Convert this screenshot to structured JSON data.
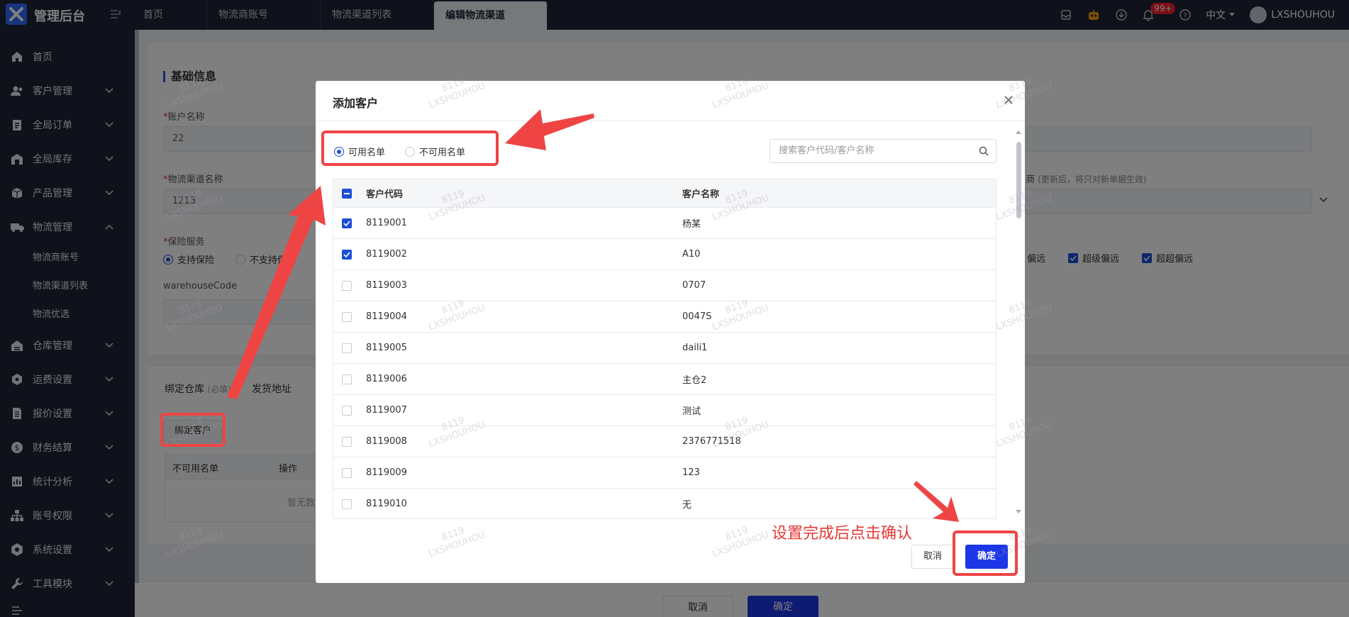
{
  "app": {
    "title": "管理后台",
    "accent": "#1d36e6",
    "top_bg": "#1f2236"
  },
  "tabs": [
    {
      "label": "首页"
    },
    {
      "label": "物流商账号"
    },
    {
      "label": "物流渠道列表"
    },
    {
      "label": "编辑物流渠道"
    }
  ],
  "header": {
    "notify_count": "99+",
    "language": "中文",
    "user": "LXSHOUHOU"
  },
  "sidebar": {
    "items": [
      {
        "label": "首页",
        "icon": "home-icon"
      },
      {
        "label": "客户管理",
        "icon": "users-icon"
      },
      {
        "label": "全局订单",
        "icon": "clipboard-icon"
      },
      {
        "label": "全局库存",
        "icon": "warehouse-icon"
      },
      {
        "label": "产品管理",
        "icon": "box-icon"
      },
      {
        "label": "物流管理",
        "icon": "truck-icon"
      },
      {
        "label": "仓库管理",
        "icon": "storage-icon"
      },
      {
        "label": "运费设置",
        "icon": "cube-icon"
      },
      {
        "label": "报价设置",
        "icon": "document-icon"
      },
      {
        "label": "财务结算",
        "icon": "money-icon"
      },
      {
        "label": "统计分析",
        "icon": "chart-icon"
      },
      {
        "label": "账号权限",
        "icon": "org-icon"
      },
      {
        "label": "系统设置",
        "icon": "gear-icon"
      },
      {
        "label": "工具模块",
        "icon": "tool-icon"
      }
    ],
    "sub": [
      "物流商账号",
      "物流渠道列表",
      "物流优选"
    ]
  },
  "form": {
    "section_title": "基础信息",
    "account_name_label": "账户名称",
    "account_name_value": "22",
    "channel_name_label": "物流渠道名称",
    "channel_name_value": "1213",
    "insurance_label": "保险服务",
    "insurance_opt1": "支持保险",
    "insurance_opt2": "不支持保险",
    "warehouse_label": "warehouseCode",
    "right_label_frag": "商",
    "right_hint": "(更新后，将只对新单据生效)",
    "remote_partial": "偏远",
    "remote_super": "超级偏远",
    "remote_super2": "超超偏远"
  },
  "bind_tabs": {
    "tab1": "绑定仓库",
    "tab1_note": "(必填)",
    "tab2": "发货地址"
  },
  "bind": {
    "button": "绑定客户",
    "col1": "不可用名单",
    "col2": "操作",
    "empty": "暂无数"
  },
  "page_buttons": {
    "cancel": "取消",
    "ok": "确定"
  },
  "modal": {
    "title": "添加客户",
    "radio_available": "可用名单",
    "radio_unavailable": "不可用名单",
    "search_placeholder": "搜索客户代码/客户名称",
    "col_code": "客户代码",
    "col_name": "客户名称",
    "rows": [
      {
        "code": "8119001",
        "name": "杨某",
        "checked": true
      },
      {
        "code": "8119002",
        "name": "A10",
        "checked": true
      },
      {
        "code": "8119003",
        "name": "0707",
        "checked": false
      },
      {
        "code": "8119004",
        "name": "0047S",
        "checked": false
      },
      {
        "code": "8119005",
        "name": "daili1",
        "checked": false
      },
      {
        "code": "8119006",
        "name": "主仓2",
        "checked": false
      },
      {
        "code": "8119007",
        "name": "测试",
        "checked": false
      },
      {
        "code": "8119008",
        "name": "2376771518",
        "checked": false
      },
      {
        "code": "8119009",
        "name": "123",
        "checked": false
      },
      {
        "code": "8119010",
        "name": "无",
        "checked": false
      }
    ],
    "cancel": "取消",
    "ok": "确定"
  },
  "annotation": {
    "note": "设置完成后点击确认",
    "color": "#ef4444"
  },
  "watermark": {
    "line1": "8119",
    "line2": "LXSHOUHOU"
  }
}
